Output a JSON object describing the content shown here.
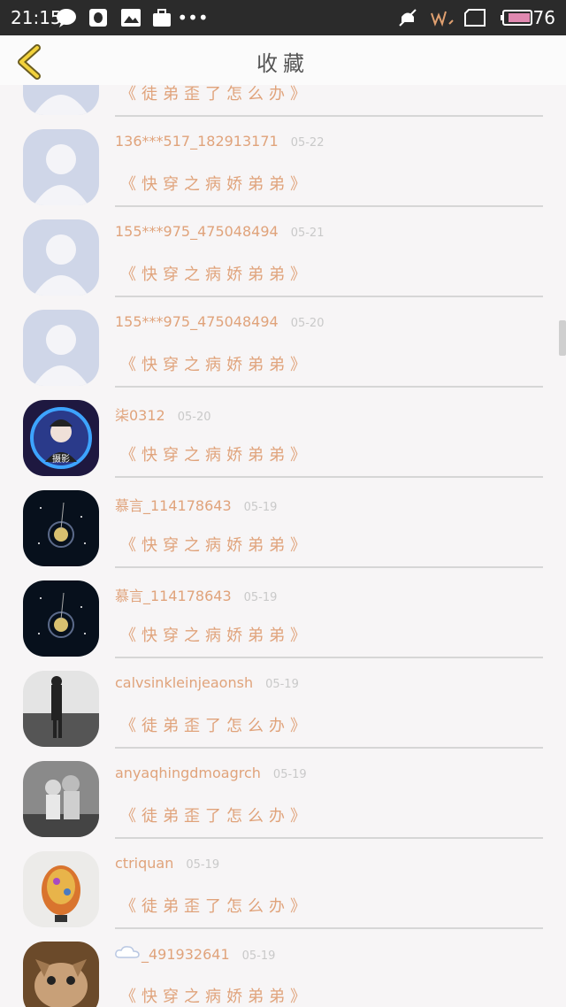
{
  "status_bar": {
    "time": "21:15",
    "battery": "76"
  },
  "header": {
    "title": "收藏"
  },
  "rows": [
    {
      "user": "",
      "date": "",
      "book": "《徒弟歪了怎么办》",
      "avatar": "default"
    },
    {
      "user": "136***517_182913171",
      "date": "05-22",
      "book": "《快穿之病娇弟弟》",
      "avatar": "default"
    },
    {
      "user": "155***975_475048494",
      "date": "05-21",
      "book": "《快穿之病娇弟弟》",
      "avatar": "default"
    },
    {
      "user": "155***975_475048494",
      "date": "05-20",
      "book": "《快穿之病娇弟弟》",
      "avatar": "default"
    },
    {
      "user": "柒0312",
      "date": "05-20",
      "book": "《快穿之病娇弟弟》",
      "avatar": "anime"
    },
    {
      "user": "慕言_114178643",
      "date": "05-19",
      "book": "《快穿之病娇弟弟》",
      "avatar": "galaxy"
    },
    {
      "user": "慕言_114178643",
      "date": "05-19",
      "book": "《快穿之病娇弟弟》",
      "avatar": "galaxy"
    },
    {
      "user": "calvsinkleinjeaonsh",
      "date": "05-19",
      "book": "《徒弟歪了怎么办》",
      "avatar": "man"
    },
    {
      "user": "anyaqhingdmoagrch",
      "date": "05-19",
      "book": "《徒弟歪了怎么办》",
      "avatar": "kids"
    },
    {
      "user": "ctriquan",
      "date": "05-19",
      "book": "《徒弟歪了怎么办》",
      "avatar": "vase"
    },
    {
      "user": "_491932641",
      "date": "05-19",
      "book": "《快穿之病娇弟弟》",
      "avatar": "cat"
    }
  ]
}
